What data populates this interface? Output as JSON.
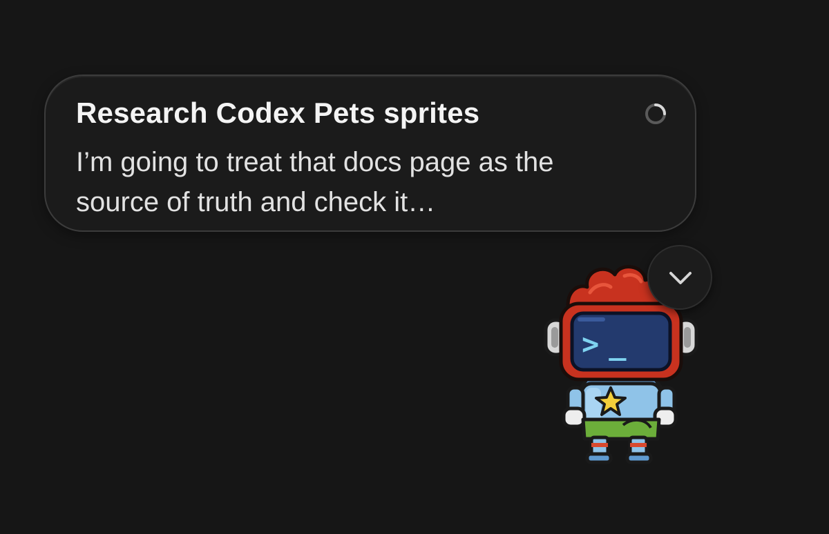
{
  "task": {
    "title": "Research Codex Pets sprites",
    "summary": "I’m going to treat that docs page as the source of truth and check it…",
    "status": "in-progress"
  },
  "icons": {
    "status": "spinner-icon",
    "collapse": "chevron-down-icon",
    "pet": "codex-robot-pet"
  },
  "pet": {
    "screen_text": ">_"
  },
  "colors": {
    "background": "#161616",
    "card_background": "#1b1b1b",
    "card_border": "#3c3c3c",
    "title_text": "#f4f4f4",
    "body_text": "#e2e2e2",
    "pet_hair": "#c8321f",
    "pet_screen": "#233a6e",
    "pet_prompt": "#7fd3f0",
    "pet_body": "#8fc3e8",
    "pet_star": "#f3cf3a"
  }
}
